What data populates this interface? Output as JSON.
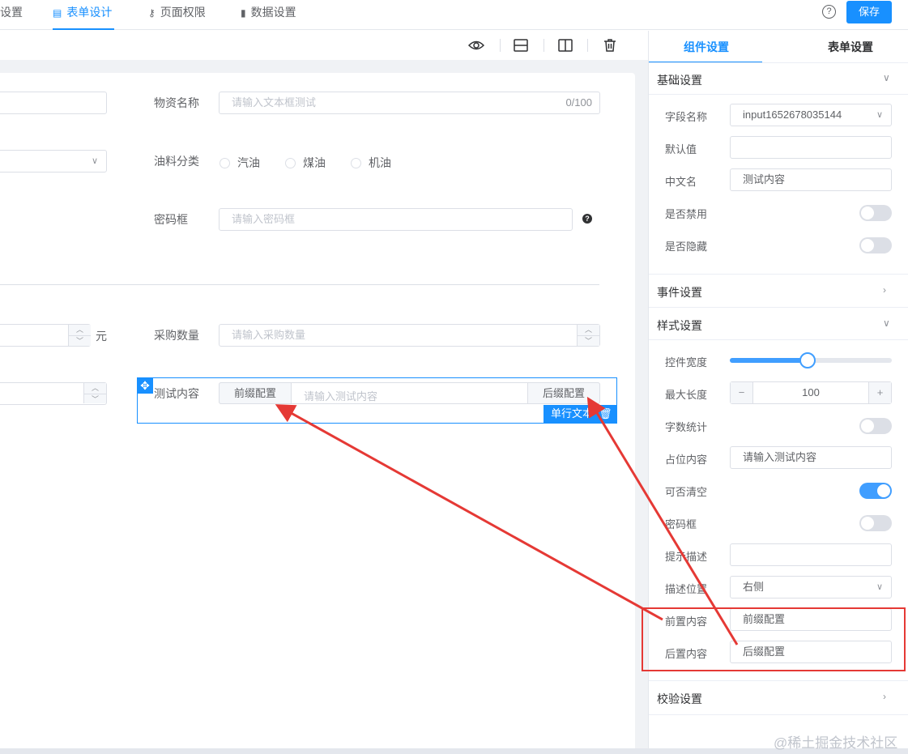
{
  "tabs": [
    {
      "label": "设置",
      "icon": ""
    },
    {
      "label": "表单设计",
      "icon": "document-icon"
    },
    {
      "label": "页面权限",
      "icon": "key-icon"
    },
    {
      "label": "数据设置",
      "icon": "bar-chart-icon"
    }
  ],
  "save_label": "保存",
  "form": {
    "wuzi_label": "物资名称",
    "wuzi_placeholder": "请输入文本框测试",
    "wuzi_count": "0/100",
    "youliao_label": "油料分类",
    "radios": [
      "汽油",
      "煤油",
      "机油"
    ],
    "mima_label": "密码框",
    "mima_placeholder": "请输入密码框",
    "yuan": "元",
    "caigou_label": "采购数量",
    "caigou_placeholder": "请输入采购数量",
    "ceshi_label": "测试内容",
    "prefix": "前缀配置",
    "ceshi_placeholder": "请输入测试内容",
    "suffix": "后缀配置",
    "tag": "单行文本"
  },
  "panel": {
    "tab_component": "组件设置",
    "tab_form": "表单设置",
    "sec_basic": "基础设置",
    "sec_event": "事件设置",
    "sec_style": "样式设置",
    "sec_validate": "校验设置",
    "field_name_label": "字段名称",
    "field_name_value": "input1652678035144",
    "default_label": "默认值",
    "default_value": "",
    "cn_label": "中文名",
    "cn_value": "测试内容",
    "disabled_label": "是否禁用",
    "hidden_label": "是否隐藏",
    "width_label": "控件宽度",
    "width_value": 0.48,
    "maxlen_label": "最大长度",
    "maxlen_value": "100",
    "minus": "−",
    "plus": "+",
    "count_label": "字数统计",
    "placeholder_label": "占位内容",
    "placeholder_value": "请输入测试内容",
    "clear_label": "可否清空",
    "password_label": "密码框",
    "tip_label": "提示描述",
    "tip_value": "",
    "tippos_label": "描述位置",
    "tippos_value": "右侧",
    "prefix_label": "前置内容",
    "prefix_value": "前缀配置",
    "suffix_label": "后置内容",
    "suffix_value": "后缀配置"
  },
  "watermark": "@稀土掘金技术社区",
  "colors": {
    "accent": "#1890ff",
    "annotation": "#e53935"
  }
}
